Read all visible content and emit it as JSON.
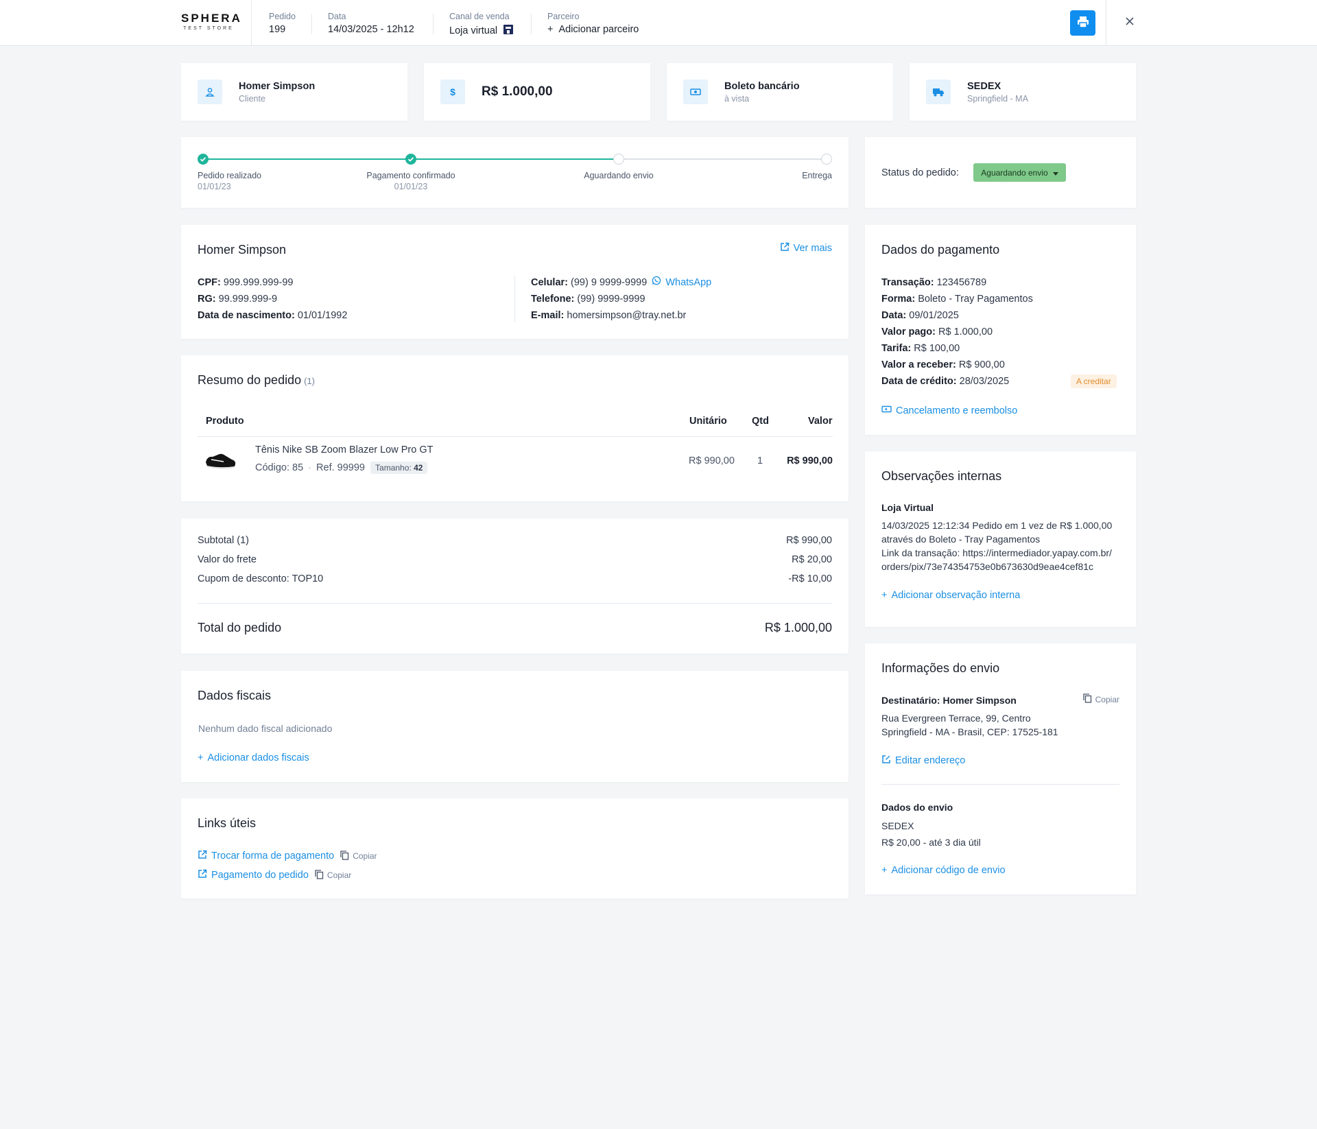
{
  "header": {
    "logo_main": "SPHERA",
    "logo_sub": "TEST STORE",
    "order_label": "Pedido",
    "order_value": "199",
    "date_label": "Data",
    "date_value": "14/03/2025 - 12h12",
    "channel_label": "Canal de venda",
    "channel_value": "Loja virtual",
    "partner_label": "Parceiro",
    "partner_action": "Adicionar parceiro"
  },
  "summary": [
    {
      "title": "Homer Simpson",
      "subtitle": "Cliente",
      "icon": "user-icon"
    },
    {
      "title": "R$ 1.000,00",
      "icon": "dollar-icon"
    },
    {
      "title": "Boleto bancário",
      "subtitle": "à vista",
      "icon": "cash-icon"
    },
    {
      "title": "SEDEX",
      "subtitle": "Springfield  - MA",
      "icon": "truck-icon"
    }
  ],
  "progress": {
    "steps": [
      {
        "label": "Pedido realizado",
        "date": "01/01/23",
        "done": true
      },
      {
        "label": "Pagamento confirmado",
        "date": "01/01/23",
        "done": true
      },
      {
        "label": "Aguardando envio",
        "date": "",
        "done": false
      },
      {
        "label": "Entrega",
        "date": "",
        "done": false
      }
    ]
  },
  "status": {
    "label": "Status do pedido:",
    "value": "Aguardando envio"
  },
  "customer": {
    "name": "Homer Simpson",
    "see_more": "Ver mais",
    "cpf_label": "CPF:",
    "cpf": "999.999.999-99",
    "rg_label": "RG:",
    "rg": "99.999.999-9",
    "birth_label": "Data de nascimento:",
    "birth": "01/01/1992",
    "cell_label": "Celular:",
    "cell": "(99) 9 9999-9999",
    "whatsapp": "WhatsApp",
    "phone_label": "Telefone:",
    "phone": "(99) 9999-9999",
    "email_label": "E-mail:",
    "email": "homersimpson@tray.net.br"
  },
  "order_summary": {
    "title": "Resumo do pedido",
    "count": "(1)",
    "col_product": "Produto",
    "col_unit": "Unitário",
    "col_qty": "Qtd",
    "col_value": "Valor",
    "item": {
      "name": "Tênis Nike SB Zoom Blazer Low Pro GT",
      "code": "Código: 85",
      "ref": "Ref. 99999",
      "size_label": "Tamanho:",
      "size": "42",
      "unit": "R$ 990,00",
      "qty": "1",
      "value": "R$ 990,00"
    }
  },
  "totals": {
    "subtotal_label": "Subtotal (1)",
    "subtotal": "R$ 990,00",
    "shipping_label": "Valor do frete",
    "shipping": "R$ 20,00",
    "coupon_label": "Cupom de desconto: TOP10",
    "coupon": "-R$ 10,00",
    "total_label": "Total do pedido",
    "total": "R$ 1.000,00"
  },
  "fiscal": {
    "title": "Dados fiscais",
    "empty": "Nenhum dado fiscal adicionado",
    "add": "Adicionar dados fiscais"
  },
  "links": {
    "title": "Links úteis",
    "items": [
      {
        "label": "Trocar forma de pagamento",
        "copy": "Copiar"
      },
      {
        "label": "Pagamento do pedido",
        "copy": "Copiar"
      }
    ]
  },
  "payment": {
    "title": "Dados do pagamento",
    "transaction_label": "Transação:",
    "transaction": "123456789",
    "form_label": "Forma:",
    "form": "Boleto - Tray Pagamentos",
    "date_label": "Data:",
    "date": "09/01/2025",
    "paid_label": "Valor pago:",
    "paid": "R$ 1.000,00",
    "fee_label": "Tarifa:",
    "fee": "R$ 100,00",
    "receive_label": "Valor a receber:",
    "receive": "R$ 900,00",
    "credit_label": "Data de crédito:",
    "credit": "28/03/2025",
    "credit_tag": "A creditar",
    "refund": "Cancelamento e reembolso"
  },
  "notes": {
    "title": "Observações internas",
    "source": "Loja Virtual",
    "line1": "14/03/2025 12:12:34 Pedido em 1 vez de R$ 1.000,00",
    "line2": "através do Boleto - Tray Pagamentos",
    "line3": "Link da transação: https://intermediador.yapay.com.br/",
    "line4": "orders/pix/73e74354753e0b673630d9eae4cef81c",
    "add": "Adicionar observação interna"
  },
  "shipping": {
    "title": "Informações do envio",
    "recipient": "Destinatário: Homer Simpson",
    "copy": "Copiar",
    "address1": "Rua Evergreen Terrace, 99, Centro",
    "address2": "Springfield  - MA - Brasil, CEP: 17525-181",
    "edit": "Editar endereço",
    "data_title": "Dados do envio",
    "method": "SEDEX",
    "price": "R$ 20,00 - até 3 dia útil",
    "add_code": "Adicionar código de envio"
  },
  "colors": {
    "accent": "#1a8fe3",
    "success": "#1fb59a",
    "status_bg": "#7fc98a",
    "tag_bg": "#fdf1e3"
  }
}
